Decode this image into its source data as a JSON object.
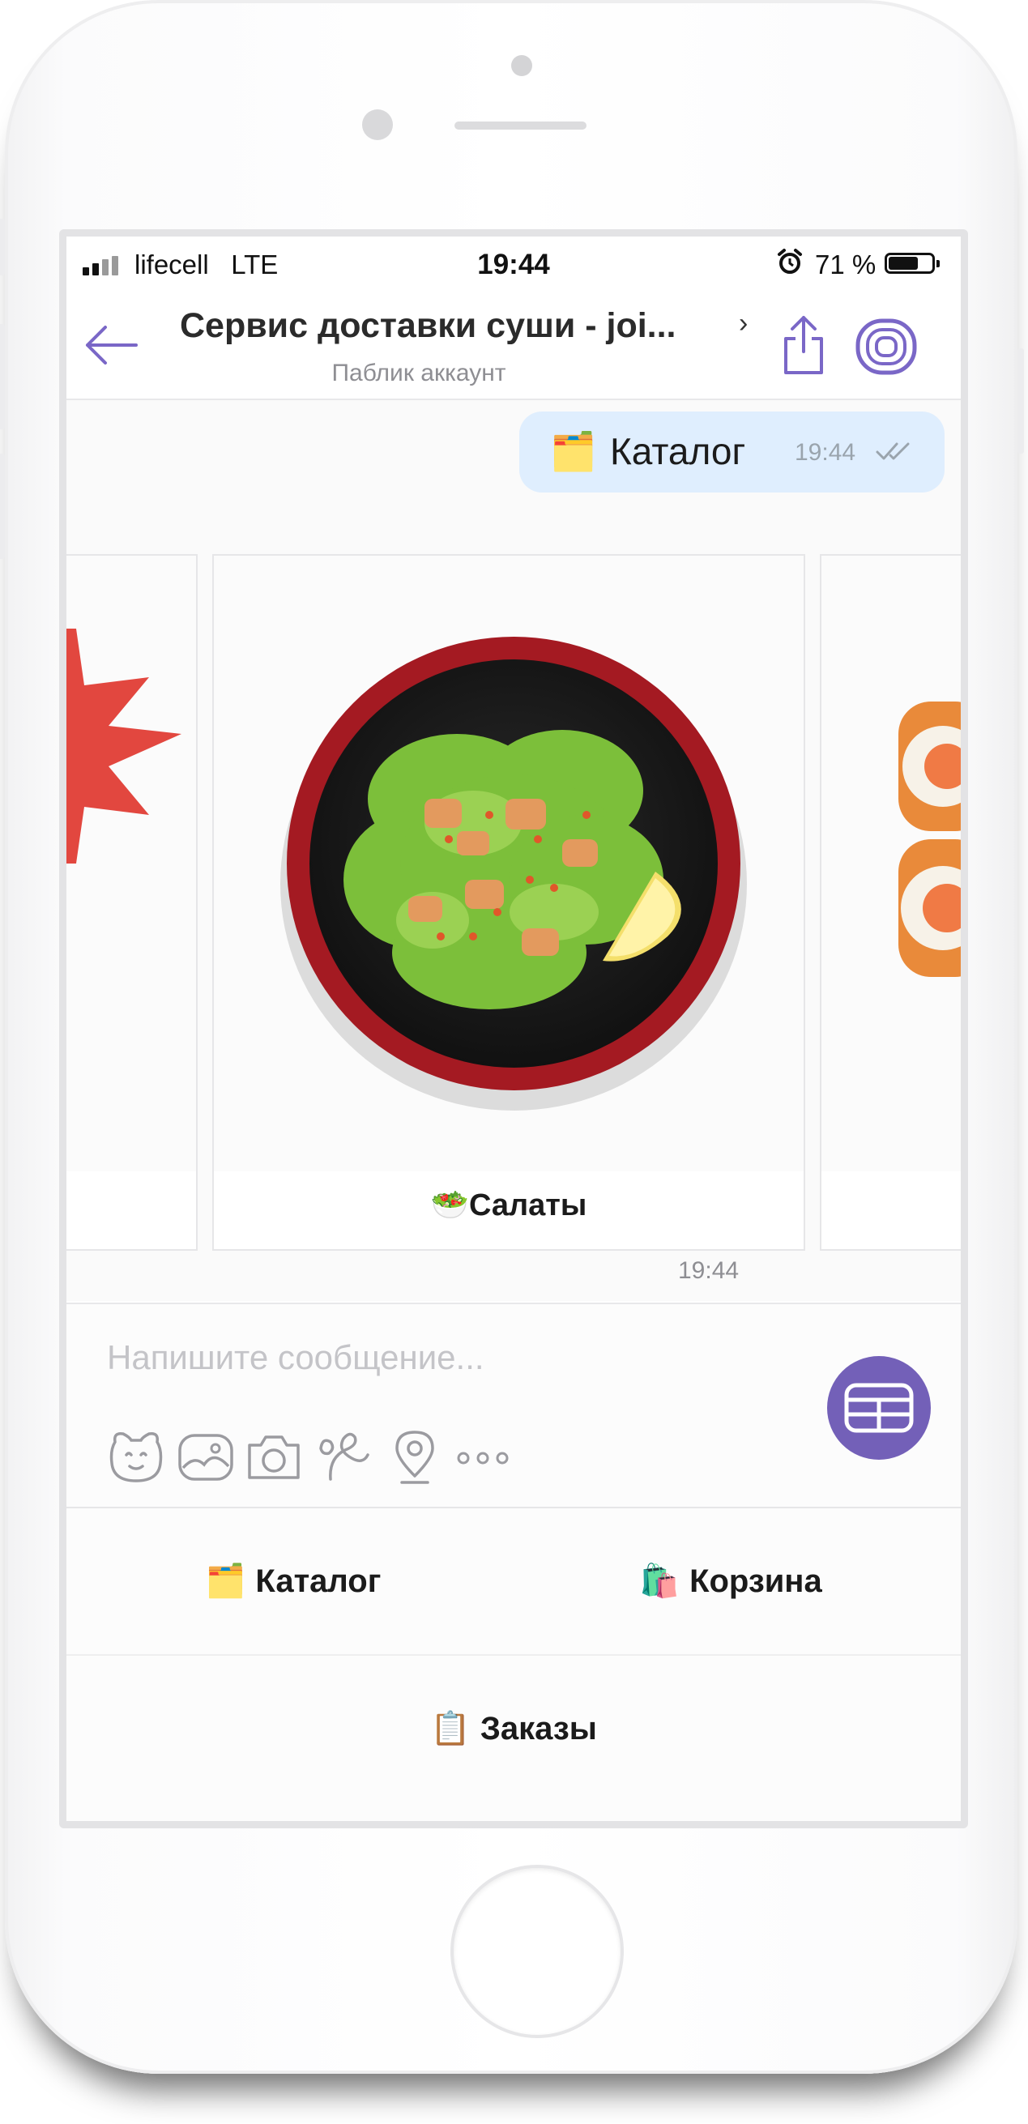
{
  "status_bar": {
    "carrier": "lifecell",
    "network": "LTE",
    "time": "19:44",
    "battery_percent": "71 %",
    "battery_level": 0.71
  },
  "header": {
    "title": "Сервис доставки суши - joi...",
    "subtitle": "Паблик аккаунт"
  },
  "chat": {
    "sent_message": {
      "emoji": "🗂️",
      "text": "Каталог",
      "time": "19:44"
    },
    "carousel": {
      "cards": [
        {
          "label": ""
        },
        {
          "emoji": "🥗",
          "label": "Салаты"
        },
        {
          "label": ""
        }
      ],
      "time": "19:44"
    }
  },
  "composer": {
    "placeholder": "Напишите сообщение...",
    "toolbar": [
      "sticker-icon",
      "gallery-icon",
      "camera-icon",
      "doodle-icon",
      "location-icon",
      "more-icon"
    ]
  },
  "keyboard": {
    "catalog": {
      "emoji": "🗂️",
      "label": "Каталог"
    },
    "cart": {
      "emoji": "🛍️",
      "label": "Корзина"
    },
    "orders": {
      "emoji": "📋",
      "label": "Заказы"
    }
  },
  "colors": {
    "accent": "#7360b8",
    "bubble": "#dfeefe",
    "red": "#e2473f"
  }
}
